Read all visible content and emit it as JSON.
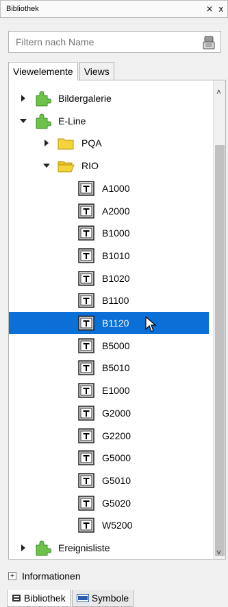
{
  "window": {
    "title": "Bibliothek",
    "pin_glyph": "⨯",
    "close_glyph": "x"
  },
  "filter": {
    "placeholder": "Filtern nach Name",
    "value": ""
  },
  "tabs": [
    {
      "label": "Viewelemente",
      "active": true
    },
    {
      "label": "Views",
      "active": false
    }
  ],
  "tree": {
    "nodes": [
      {
        "label": "Bildergalerie",
        "icon": "puzzle-icon",
        "expander": "collapsed"
      },
      {
        "label": "E-Line",
        "icon": "puzzle-icon",
        "expander": "expanded"
      },
      {
        "label": "PQA",
        "icon": "folder-icon",
        "expander": "collapsed"
      },
      {
        "label": "RIO",
        "icon": "folder-open-icon",
        "expander": "expanded"
      },
      {
        "label": "A1000",
        "icon": "t-element-icon"
      },
      {
        "label": "A2000",
        "icon": "t-element-icon"
      },
      {
        "label": "B1000",
        "icon": "t-element-icon"
      },
      {
        "label": "B1010",
        "icon": "t-element-icon"
      },
      {
        "label": "B1020",
        "icon": "t-element-icon"
      },
      {
        "label": "B1100",
        "icon": "t-element-icon"
      },
      {
        "label": "B1120",
        "icon": "t-element-icon",
        "selected": true
      },
      {
        "label": "B5000",
        "icon": "t-element-icon"
      },
      {
        "label": "B5010",
        "icon": "t-element-icon"
      },
      {
        "label": "E1000",
        "icon": "t-element-icon"
      },
      {
        "label": "G2000",
        "icon": "t-element-icon"
      },
      {
        "label": "G2200",
        "icon": "t-element-icon"
      },
      {
        "label": "G5000",
        "icon": "t-element-icon"
      },
      {
        "label": "G5010",
        "icon": "t-element-icon"
      },
      {
        "label": "G5020",
        "icon": "t-element-icon"
      },
      {
        "label": "W5200",
        "icon": "t-element-icon"
      },
      {
        "label": "Ereignisliste",
        "icon": "puzzle-icon",
        "expander": "collapsed"
      }
    ]
  },
  "info_panel": {
    "label": "Informationen"
  },
  "bottom_tabs": [
    {
      "label": "Bibliothek",
      "active": true,
      "icon": "library-icon"
    },
    {
      "label": "Symbole",
      "active": false,
      "icon": "symbols-icon"
    }
  ],
  "colors": {
    "selection": "#0a6fd6",
    "puzzle": "#6cc24a",
    "folder": "#f5d33b"
  }
}
